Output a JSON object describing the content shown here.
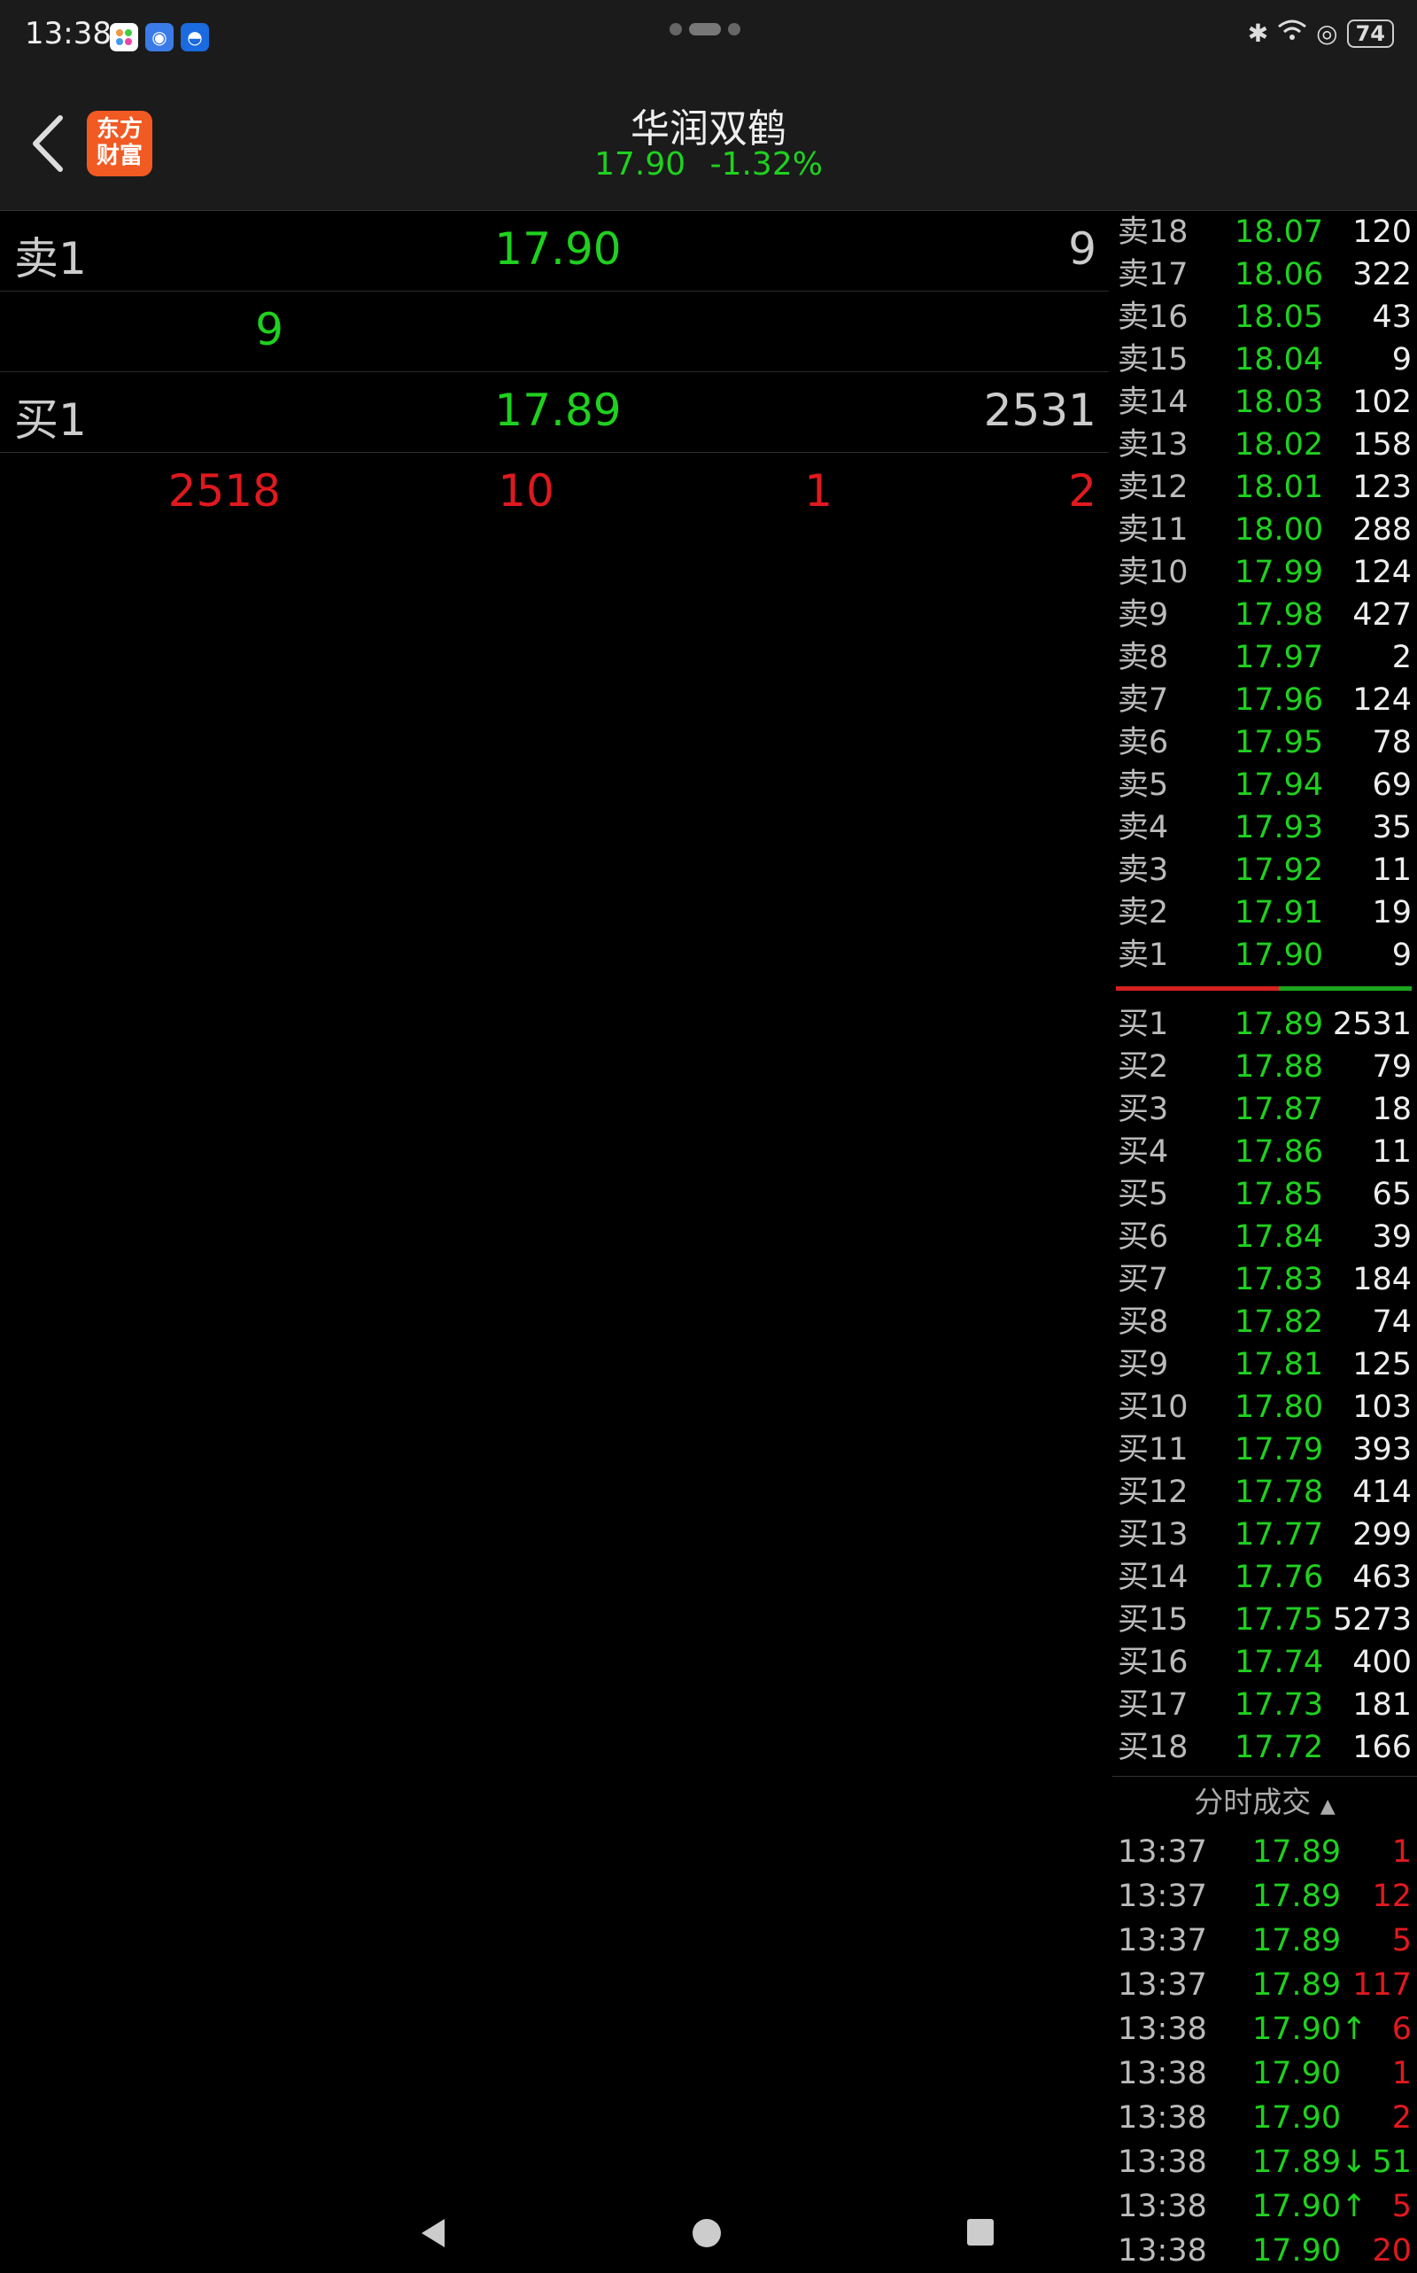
{
  "status_bar": {
    "time": "13:38",
    "battery": "74"
  },
  "header": {
    "title": "华润双鹤",
    "price": "17.90",
    "change": "-1.32%",
    "logo_line1": "东方",
    "logo_line2": "财富"
  },
  "left_panel": {
    "sell_label": "卖1",
    "sell_price": "17.90",
    "sell_volume": "9",
    "mid_value": "9",
    "buy_label": "买1",
    "buy_price": "17.89",
    "buy_volume": "2531",
    "stats": [
      "2518",
      "10",
      "1",
      "2"
    ]
  },
  "sell_orders": [
    {
      "label": "卖18",
      "price": "18.07",
      "volume": "120"
    },
    {
      "label": "卖17",
      "price": "18.06",
      "volume": "322"
    },
    {
      "label": "卖16",
      "price": "18.05",
      "volume": "43"
    },
    {
      "label": "卖15",
      "price": "18.04",
      "volume": "9"
    },
    {
      "label": "卖14",
      "price": "18.03",
      "volume": "102"
    },
    {
      "label": "卖13",
      "price": "18.02",
      "volume": "158"
    },
    {
      "label": "卖12",
      "price": "18.01",
      "volume": "123"
    },
    {
      "label": "卖11",
      "price": "18.00",
      "volume": "288"
    },
    {
      "label": "卖10",
      "price": "17.99",
      "volume": "124"
    },
    {
      "label": "卖9",
      "price": "17.98",
      "volume": "427"
    },
    {
      "label": "卖8",
      "price": "17.97",
      "volume": "2"
    },
    {
      "label": "卖7",
      "price": "17.96",
      "volume": "124"
    },
    {
      "label": "卖6",
      "price": "17.95",
      "volume": "78"
    },
    {
      "label": "卖5",
      "price": "17.94",
      "volume": "69"
    },
    {
      "label": "卖4",
      "price": "17.93",
      "volume": "35"
    },
    {
      "label": "卖3",
      "price": "17.92",
      "volume": "11"
    },
    {
      "label": "卖2",
      "price": "17.91",
      "volume": "19"
    },
    {
      "label": "卖1",
      "price": "17.90",
      "volume": "9"
    }
  ],
  "buy_orders": [
    {
      "label": "买1",
      "price": "17.89",
      "volume": "2531"
    },
    {
      "label": "买2",
      "price": "17.88",
      "volume": "79"
    },
    {
      "label": "买3",
      "price": "17.87",
      "volume": "18"
    },
    {
      "label": "买4",
      "price": "17.86",
      "volume": "11"
    },
    {
      "label": "买5",
      "price": "17.85",
      "volume": "65"
    },
    {
      "label": "买6",
      "price": "17.84",
      "volume": "39"
    },
    {
      "label": "买7",
      "price": "17.83",
      "volume": "184"
    },
    {
      "label": "买8",
      "price": "17.82",
      "volume": "74"
    },
    {
      "label": "买9",
      "price": "17.81",
      "volume": "125"
    },
    {
      "label": "买10",
      "price": "17.80",
      "volume": "103"
    },
    {
      "label": "买11",
      "price": "17.79",
      "volume": "393"
    },
    {
      "label": "买12",
      "price": "17.78",
      "volume": "414"
    },
    {
      "label": "买13",
      "price": "17.77",
      "volume": "299"
    },
    {
      "label": "买14",
      "price": "17.76",
      "volume": "463"
    },
    {
      "label": "买15",
      "price": "17.75",
      "volume": "5273"
    },
    {
      "label": "买16",
      "price": "17.74",
      "volume": "400"
    },
    {
      "label": "买17",
      "price": "17.73",
      "volume": "181"
    },
    {
      "label": "买18",
      "price": "17.72",
      "volume": "166"
    }
  ],
  "ticks_header": "分时成交",
  "ticks": [
    {
      "time": "13:37",
      "price": "17.89",
      "volume": "1",
      "color": "#e0191f"
    },
    {
      "time": "13:37",
      "price": "17.89",
      "volume": "12",
      "color": "#e0191f"
    },
    {
      "time": "13:37",
      "price": "17.89",
      "volume": "5",
      "color": "#e0191f"
    },
    {
      "time": "13:37",
      "price": "17.89",
      "volume": "117",
      "color": "#e0191f"
    },
    {
      "time": "13:38",
      "price": "17.90↑",
      "volume": "6",
      "color": "#e0191f"
    },
    {
      "time": "13:38",
      "price": "17.90",
      "volume": "1",
      "color": "#e0191f"
    },
    {
      "time": "13:38",
      "price": "17.90",
      "volume": "2",
      "color": "#e0191f"
    },
    {
      "time": "13:38",
      "price": "17.89↓",
      "volume": "51",
      "color": "#1fd11f"
    },
    {
      "time": "13:38",
      "price": "17.90↑",
      "volume": "5",
      "color": "#e0191f"
    },
    {
      "time": "13:38",
      "price": "17.90",
      "volume": "20",
      "color": "#e0191f"
    }
  ],
  "icons": {
    "back": "back-arrow-icon",
    "nav_back": "triangle-back-icon",
    "nav_home": "circle-home-icon",
    "nav_recent": "square-recent-icon"
  }
}
